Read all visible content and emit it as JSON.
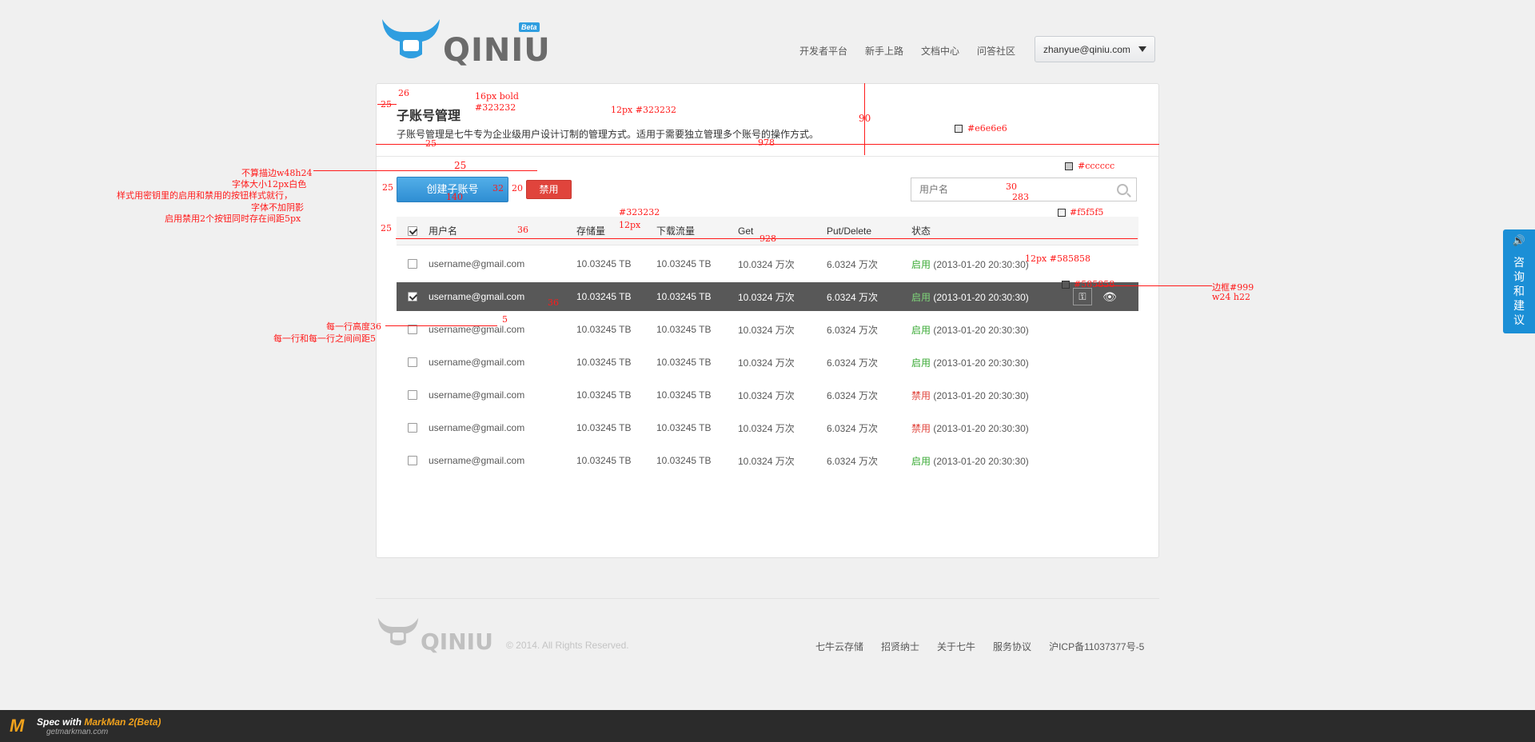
{
  "brand": {
    "name": "QINIU",
    "badge": "Beta"
  },
  "nav": {
    "links": [
      "开发者平台",
      "新手上路",
      "文档中心",
      "问答社区"
    ],
    "user": "zhanyue@qiniu.com"
  },
  "page": {
    "title": "子账号管理",
    "description": "子账号管理是七牛专为企业级用户设计订制的管理方式。适用于需要独立管理多个账号的操作方式。"
  },
  "toolbar": {
    "create_label": "创建子账号",
    "disable_label": "禁用",
    "search_placeholder": "用户名"
  },
  "table": {
    "headers": [
      "用户名",
      "存储量",
      "下载流量",
      "Get",
      "Put/Delete",
      "状态"
    ],
    "rows": [
      {
        "user": "username@gmail.com",
        "storage": "10.03245 TB",
        "download": "10.03245 TB",
        "get": "10.0324 万次",
        "put": "6.0324 万次",
        "status": "启用",
        "time": "(2013-01-20 20:30:30)",
        "checked": false,
        "selected": false
      },
      {
        "user": "username@gmail.com",
        "storage": "10.03245 TB",
        "download": "10.03245 TB",
        "get": "10.0324 万次",
        "put": "6.0324 万次",
        "status": "启用",
        "time": "(2013-01-20 20:30:30)",
        "checked": true,
        "selected": true
      },
      {
        "user": "username@gmail.com",
        "storage": "10.03245 TB",
        "download": "10.03245 TB",
        "get": "10.0324 万次",
        "put": "6.0324 万次",
        "status": "启用",
        "time": "(2013-01-20 20:30:30)",
        "checked": false,
        "selected": false
      },
      {
        "user": "username@gmail.com",
        "storage": "10.03245 TB",
        "download": "10.03245 TB",
        "get": "10.0324 万次",
        "put": "6.0324 万次",
        "status": "启用",
        "time": "(2013-01-20 20:30:30)",
        "checked": false,
        "selected": false
      },
      {
        "user": "username@gmail.com",
        "storage": "10.03245 TB",
        "download": "10.03245 TB",
        "get": "10.0324 万次",
        "put": "6.0324 万次",
        "status": "禁用",
        "time": "(2013-01-20 20:30:30)",
        "checked": false,
        "selected": false
      },
      {
        "user": "username@gmail.com",
        "storage": "10.03245 TB",
        "download": "10.03245 TB",
        "get": "10.0324 万次",
        "put": "6.0324 万次",
        "status": "禁用",
        "time": "(2013-01-20 20:30:30)",
        "checked": false,
        "selected": false
      },
      {
        "user": "username@gmail.com",
        "storage": "10.03245 TB",
        "download": "10.03245 TB",
        "get": "10.0324 万次",
        "put": "6.0324 万次",
        "status": "启用",
        "time": "(2013-01-20 20:30:30)",
        "checked": false,
        "selected": false
      }
    ]
  },
  "footer": {
    "copyright": "© 2014. All Rights Reserved.",
    "links": [
      "七牛云存储",
      "招贤纳士",
      "关于七牛",
      "服务协议",
      "沪ICP备11037377号-5"
    ]
  },
  "feedback": {
    "label": "咨询和建议"
  },
  "markman": {
    "line1_prefix": "Spec with ",
    "line1_brand": "MarkMan 2(Beta)",
    "line2": "getmarkman.com"
  },
  "colors": {
    "text": "#323232",
    "muted": "#585858",
    "divider": "#e6e6e6",
    "border": "#cccccc",
    "head_bg": "#f5f5f5",
    "selected_bg": "#585858",
    "primary": "#2f8ed3",
    "danger": "#e0443c",
    "success": "#3aaa35"
  },
  "annotations": {
    "title_font": "16px bold",
    "title_color": "#323232",
    "desc_font": "12px  #323232",
    "divider_color": "#e6e6e6",
    "border_color": "#cccccc",
    "head_color": "#f5f5f5",
    "head_font_color": "#323232",
    "head_font": "12px",
    "row_font": "12px #585858",
    "row_bg": "#585858",
    "action_border": "边框#999",
    "action_size": "w24   h22",
    "btn_note_1": "不算描边w48h24",
    "btn_note_2": "字体大小12px白色",
    "btn_note_3": "样式用密钥里的启用和禁用的按钮样式就行，",
    "btn_note_4": "字体不加阴影",
    "btn_note_5": "启用禁用2个按钮同时存在间距5px",
    "row_note_1": "每一行高度36",
    "row_note_2": "每一行和每一行之间间距5",
    "m_25a": "25",
    "m_26": "26",
    "m_25b": "25",
    "m_90": "90",
    "m_978": "978",
    "m_25c": "25",
    "m_25d": "25",
    "m_32": "32",
    "m_20": "20",
    "m_140": "140",
    "m_30": "30",
    "m_283": "283",
    "m_25e": "25",
    "m_36a": "36",
    "m_928": "928",
    "m_36b": "36",
    "m_5": "5"
  }
}
